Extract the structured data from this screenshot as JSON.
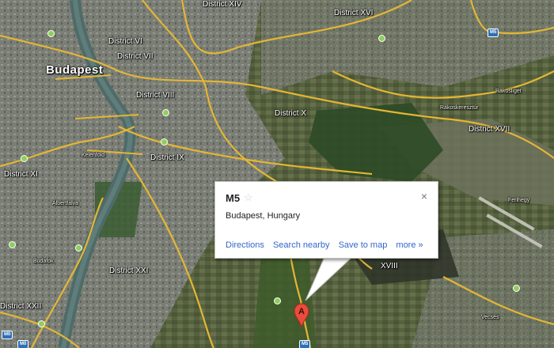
{
  "map": {
    "city_label": "Budapest",
    "districts": [
      {
        "key": "xiv",
        "label": "District XIV"
      },
      {
        "key": "xvi",
        "label": "District XVI"
      },
      {
        "key": "vi",
        "label": "District VI"
      },
      {
        "key": "vii",
        "label": "District VII"
      },
      {
        "key": "viii",
        "label": "District VIII"
      },
      {
        "key": "x",
        "label": "District X"
      },
      {
        "key": "xvii",
        "label": "District XVII"
      },
      {
        "key": "ix",
        "label": "District IX"
      },
      {
        "key": "xi",
        "label": "District XI"
      },
      {
        "key": "xviii",
        "label": "XVIII"
      },
      {
        "key": "xxi",
        "label": "District XXI"
      },
      {
        "key": "xxii",
        "label": "District XXII"
      }
    ],
    "small_places": [
      "Rákoskeresztúr",
      "Vecsés",
      "Rákosliget",
      "Kelenföld",
      "Albertfalva",
      "Budafok",
      "Ferihegy"
    ],
    "shields": [
      "M5",
      "M0",
      "M0",
      "M5"
    ],
    "marker_letter": "A"
  },
  "popup": {
    "title": "M5",
    "star_icon": "star-outline",
    "close_icon": "×",
    "address": "Budapest, Hungary",
    "links": [
      "Directions",
      "Search nearby",
      "Save to map",
      "more »"
    ]
  },
  "colors": {
    "link": "#3366cc",
    "marker": "#e74c3c",
    "road": "#e3b634",
    "poi": "#8fcf5a"
  }
}
